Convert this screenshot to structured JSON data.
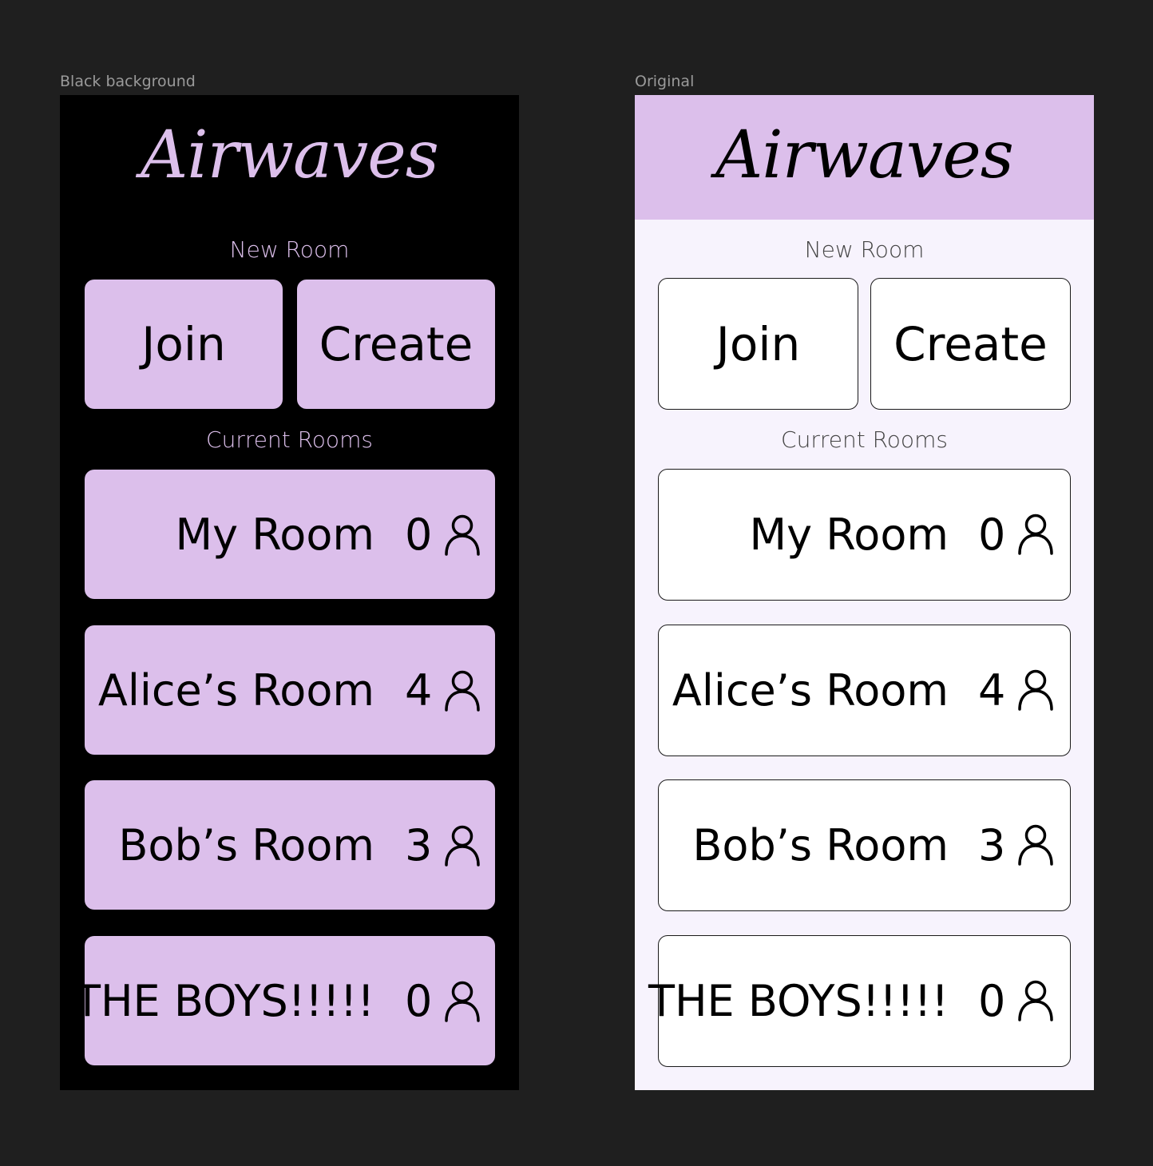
{
  "canvas": {
    "frames": [
      {
        "label": "Black background"
      },
      {
        "label": "Original"
      }
    ]
  },
  "app": {
    "logo": "Airwaves",
    "new_room_title": "New Room",
    "join_label": "Join",
    "create_label": "Create",
    "current_rooms_title": "Current Rooms",
    "rooms": [
      {
        "name": "My Room",
        "count": "0"
      },
      {
        "name": "Alice’s Room",
        "count": "4"
      },
      {
        "name": "Bob’s Room",
        "count": "3"
      },
      {
        "name": "THE BOYS!!!!!",
        "count": "0"
      }
    ]
  },
  "colors": {
    "canvas_background": "#1f1f1f",
    "accent_lavender": "#dcbfeb",
    "light_background": "#f7f3fd",
    "dark_background": "#000000"
  },
  "icons": {
    "occupant_icon": "person-outline-icon"
  }
}
